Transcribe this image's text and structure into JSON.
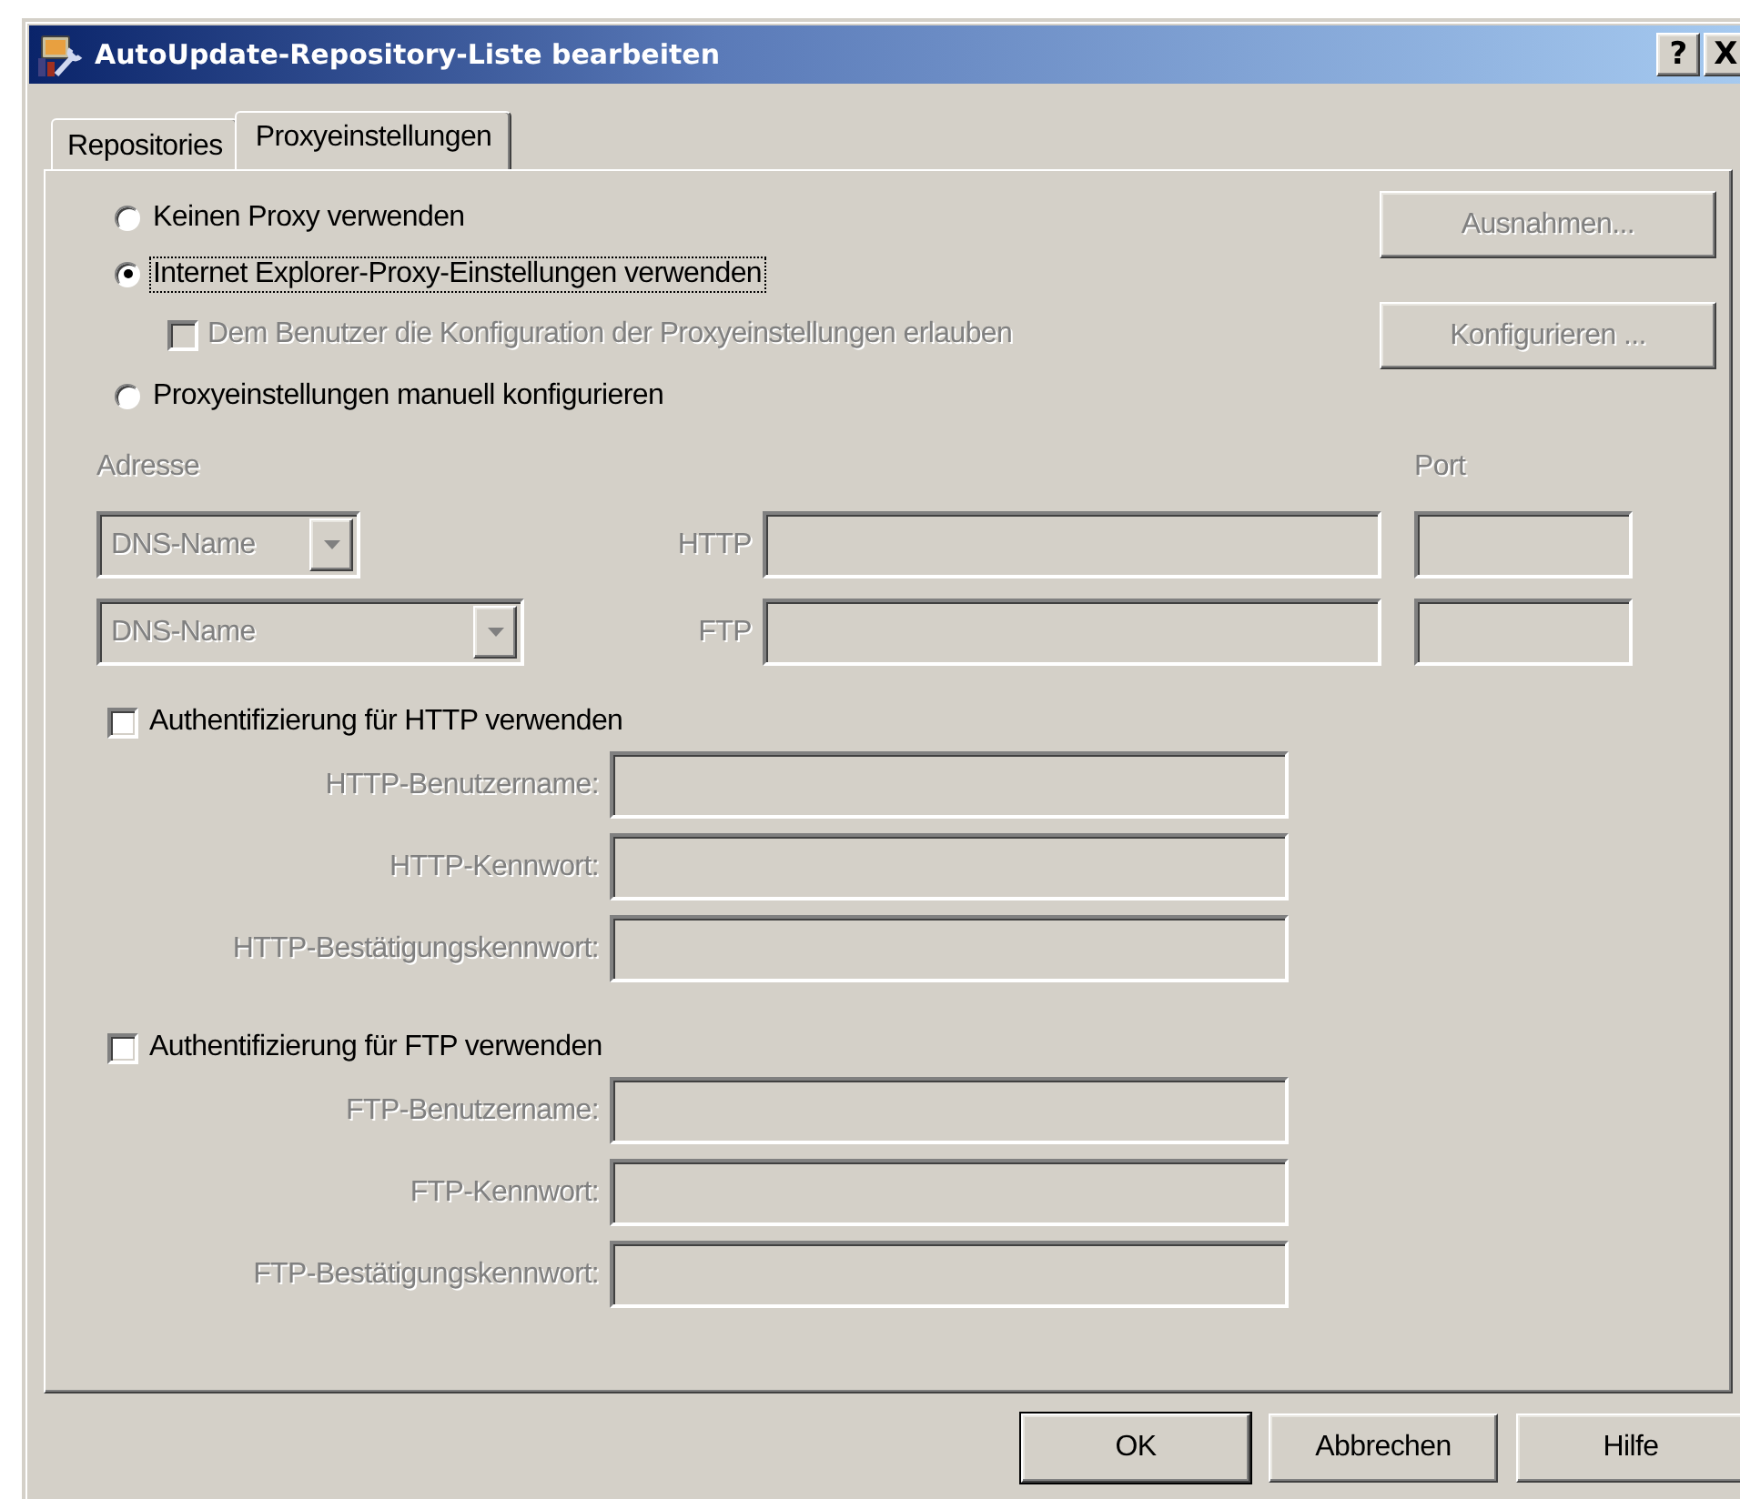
{
  "window": {
    "title": "AutoUpdate-Repository-Liste bearbeiten",
    "title_buttons": [
      "?",
      "X"
    ]
  },
  "tabs": [
    {
      "label": "Repositories",
      "selected": false
    },
    {
      "label": "Proxyeinstellungen",
      "selected": true
    }
  ],
  "proxy_options": [
    {
      "label": "Keinen Proxy verwenden",
      "selected": false,
      "focused": false
    },
    {
      "label": "Internet Explorer-Proxy-Einstellungen verwenden",
      "selected": true,
      "focused": true
    },
    {
      "label": "Proxyeinstellungen manuell konfigurieren",
      "selected": false,
      "focused": false
    }
  ],
  "allow_user_config": {
    "label": "Dem Benutzer die Konfiguration der Proxyeinstellungen erlauben",
    "checked": false,
    "disabled": true
  },
  "side_buttons": [
    {
      "label": "Ausnahmen...",
      "disabled": true
    },
    {
      "label": "Konfigurieren ...",
      "disabled": true
    }
  ],
  "address": {
    "address_label": "Adresse",
    "port_label": "Port",
    "disabled": true,
    "rows": [
      {
        "type_value": "DNS-Name",
        "protocol": "HTTP"
      },
      {
        "type_value": "DNS-Name",
        "protocol": "FTP"
      }
    ]
  },
  "auth_sections": [
    {
      "label": "Authentifizierung für HTTP verwenden",
      "checked": false,
      "fields": [
        {
          "label": "HTTP-Benutzername:",
          "disabled": true
        },
        {
          "label": "HTTP-Kennwort:",
          "disabled": true
        },
        {
          "label": "HTTP-Bestätigungskennwort:",
          "disabled": true
        }
      ]
    },
    {
      "label": "Authentifizierung für FTP verwenden",
      "checked": false,
      "fields": [
        {
          "label": "FTP-Benutzername:",
          "disabled": true
        },
        {
          "label": "FTP-Kennwort:",
          "disabled": true
        },
        {
          "label": "FTP-Bestätigungskennwort:",
          "disabled": true
        }
      ]
    }
  ],
  "buttons": [
    {
      "label": "OK",
      "default": true
    },
    {
      "label": "Abbrechen",
      "default": false
    },
    {
      "label": "Hilfe",
      "default": false
    }
  ]
}
